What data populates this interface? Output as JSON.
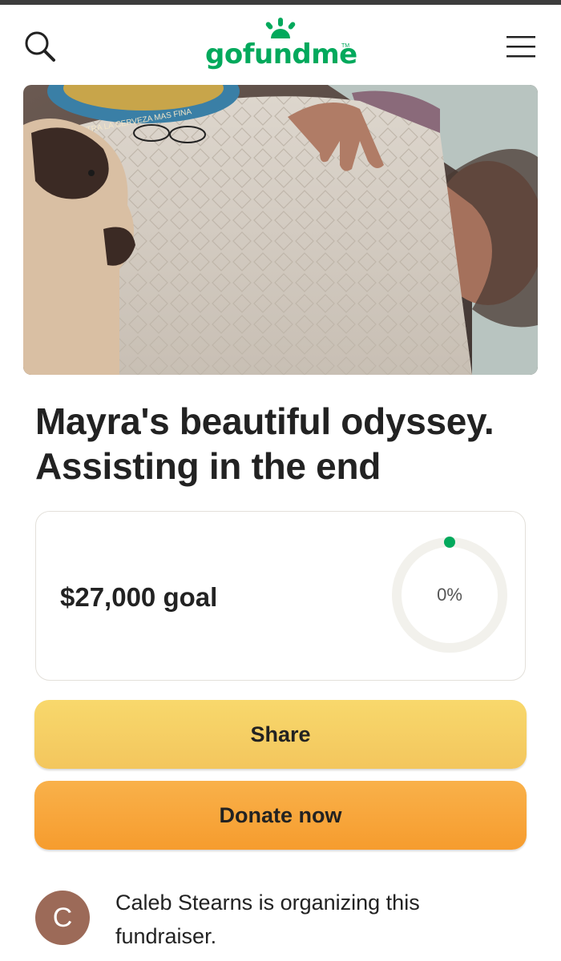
{
  "header": {
    "logo_text": "gofundme",
    "logo_tm": "TM",
    "search_icon": "search-icon",
    "menu_icon": "menu-icon"
  },
  "hero": {
    "description": ""
  },
  "campaign": {
    "title": "Mayra's beautiful odyssey. Assisting in the end",
    "goal_text": "$27,000 goal",
    "progress_label": "0%",
    "progress_fraction": 0
  },
  "actions": {
    "share_label": "Share",
    "donate_label": "Donate now"
  },
  "organizer": {
    "initial": "C",
    "text": "Caleb Stearns is organizing this fundraiser."
  },
  "colors": {
    "brand_green": "#02a95c",
    "share_yellow": "#f5cf63",
    "donate_orange": "#f7a43a",
    "avatar_brown": "#9c6a58"
  }
}
